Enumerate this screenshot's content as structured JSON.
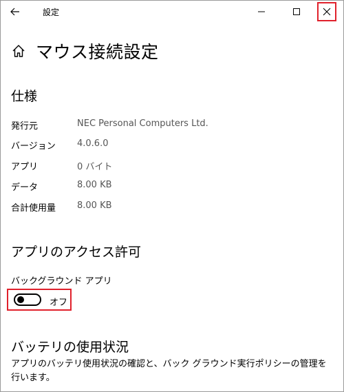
{
  "window": {
    "title": "設定"
  },
  "page": {
    "title": "マウス接続設定"
  },
  "spec": {
    "heading": "仕様",
    "rows": [
      {
        "label": "発行元",
        "value": "NEC Personal Computers  Ltd."
      },
      {
        "label": "バージョン",
        "value": "4.0.6.0"
      },
      {
        "label": "アプリ",
        "value": "0 バイト"
      },
      {
        "label": "データ",
        "value": "8.00 KB"
      },
      {
        "label": "合計使用量",
        "value": "8.00 KB"
      }
    ]
  },
  "access": {
    "heading": "アプリのアクセス許可",
    "background_label": "バックグラウンド アプリ",
    "toggle_state": "オフ",
    "toggle_on": false
  },
  "battery": {
    "heading": "バッテリの使用状況",
    "description": "アプリのバッテリ使用状況の確認と、バック グラウンド実行ポリシーの管理を行います。"
  },
  "colors": {
    "highlight": "#e0202b",
    "secondary_text": "#555555"
  },
  "icons": {
    "back": "back-arrow-icon",
    "minimize": "minimize-icon",
    "maximize": "maximize-icon",
    "close": "close-icon",
    "home": "home-icon"
  }
}
